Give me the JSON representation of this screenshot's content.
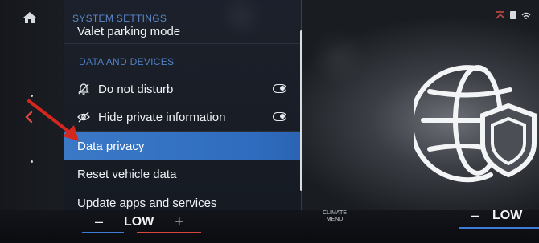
{
  "menu": {
    "title": "SYSTEM SETTINGS",
    "partial_item": "Valet parking mode",
    "section_header": "DATA AND DEVICES",
    "items": [
      {
        "label": "Do not disturb",
        "icon": "bell-off-icon",
        "toggle": "on"
      },
      {
        "label": "Hide private information",
        "icon": "eye-off-icon",
        "toggle": "on"
      },
      {
        "label": "Data privacy",
        "selected": true
      },
      {
        "label": "Reset vehicle data"
      },
      {
        "label": "Update apps and services"
      }
    ]
  },
  "climate": {
    "left": {
      "minus": "–",
      "level": "LOW",
      "plus": "+"
    },
    "menu_label": "CLIMATE MENU",
    "right": {
      "minus": "–",
      "level": "LOW"
    }
  },
  "colors": {
    "accent_blue": "#3b79c7",
    "header_blue": "#4f7fc6",
    "annotation_arrow": "#d6271f",
    "cool_bar": "#3d7bd6",
    "warm_bar": "#d8473f"
  }
}
